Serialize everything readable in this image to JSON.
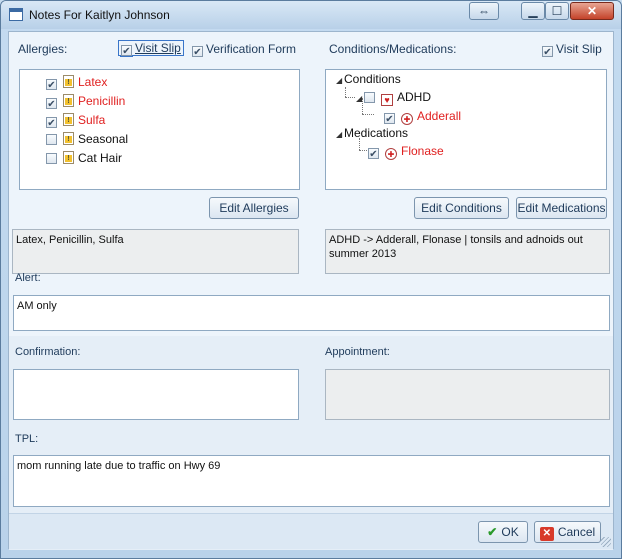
{
  "window": {
    "title": "Notes For Kaitlyn Johnson"
  },
  "allergies": {
    "label": "Allergies:",
    "visit_slip": {
      "label": "Visit Slip",
      "checked": true
    },
    "verification_form": {
      "label": "Verification Form",
      "checked": true
    },
    "items": [
      {
        "name": "Latex",
        "checked": true,
        "color": "#e02020"
      },
      {
        "name": "Penicillin",
        "checked": true,
        "color": "#e02020"
      },
      {
        "name": "Sulfa",
        "checked": true,
        "color": "#e02020"
      },
      {
        "name": "Seasonal",
        "checked": false,
        "color": "#111111"
      },
      {
        "name": "Cat Hair",
        "checked": false,
        "color": "#111111"
      }
    ],
    "edit_button": "Edit Allergies",
    "summary": "Latex, Penicillin, Sulfa"
  },
  "conditions": {
    "label": "Conditions/Medications:",
    "visit_slip": {
      "label": "Visit Slip",
      "checked": true
    },
    "tree": {
      "conditions_label": "Conditions",
      "adhd_label": "ADHD",
      "adderall_label": "Adderall",
      "medications_label": "Medications",
      "flonase_label": "Flonase"
    },
    "edit_conditions_button": "Edit Conditions",
    "edit_medications_button": "Edit Medications",
    "summary": "ADHD -> Adderall, Flonase | tonsils and adnoids out summer 2013"
  },
  "alert": {
    "label": "Alert:",
    "value": "AM only"
  },
  "confirmation": {
    "label": "Confirmation:",
    "value": ""
  },
  "appointment": {
    "label": "Appointment:",
    "value": ""
  },
  "tpl": {
    "label": "TPL:",
    "value": "mom running late due to traffic on Hwy 69"
  },
  "footer": {
    "ok_label": "OK",
    "cancel_label": "Cancel"
  },
  "icons": {
    "app": "window-icon",
    "restore": "restore-icon",
    "minimize": "minimize-icon",
    "maximize": "maximize-icon",
    "close": "close-icon",
    "allergy_item": "allergy-document-icon",
    "condition_item": "heart-icon",
    "medication_item": "pill-icon",
    "ok": "checkmark-icon",
    "cancel": "cancel-x-icon"
  },
  "colors": {
    "alert_red": "#e02020",
    "ok_green": "#2b9a2b",
    "cancel_red": "#d83a2a"
  }
}
